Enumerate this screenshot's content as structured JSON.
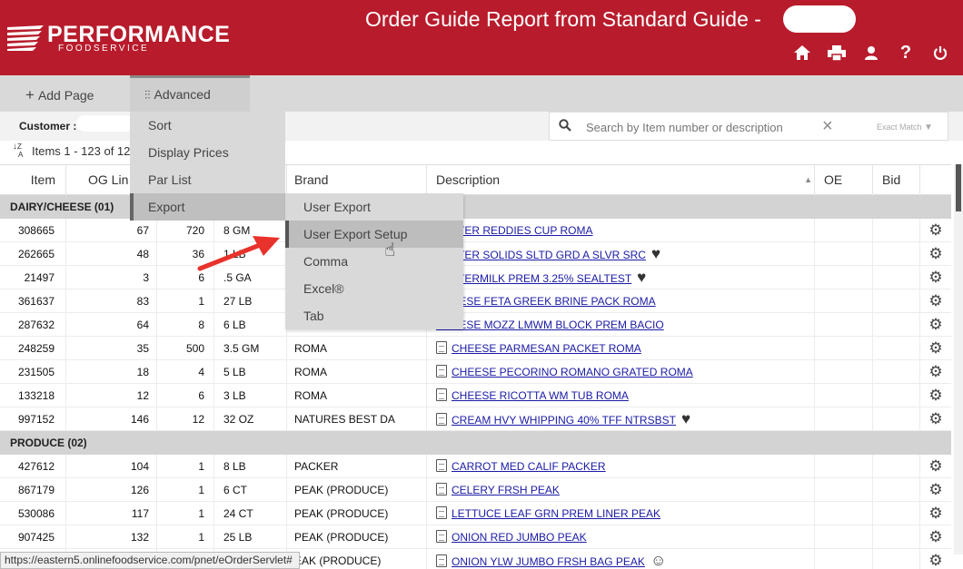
{
  "header": {
    "brand": "PERFORMANCE",
    "brand_sub": "FOODSERVICE",
    "title": "Order Guide Report from Standard Guide -",
    "icons": [
      "home-icon",
      "printer-icon",
      "user-icon",
      "help-icon",
      "power-icon"
    ]
  },
  "toolbar": {
    "add_page": "Add Page",
    "advanced": "Advanced"
  },
  "customer": {
    "label": "Customer :"
  },
  "search": {
    "placeholder": "Search by Item number or description",
    "exact_match": "Exact Match"
  },
  "items_count": "Items 1 - 123 of 12",
  "table": {
    "headers": {
      "item": "Item",
      "og_line": "OG Lin",
      "brand": "Brand",
      "description": "Description",
      "oe": "OE",
      "bid": "Bid"
    },
    "categories": [
      {
        "name": "DAIRY/CHEESE (01)",
        "rows": [
          {
            "item": "308665",
            "og": "67",
            "pack": "720",
            "size": "8 GM",
            "brand": "",
            "desc": "BUTTER REDDIES CUP ROMA",
            "heart": false,
            "pdf": false
          },
          {
            "item": "262665",
            "og": "48",
            "pack": "36",
            "size": "1 LB",
            "brand": "",
            "desc": "BUTTER SOLIDS SLTD GRD A SLVR SRC",
            "heart": true,
            "pdf": false
          },
          {
            "item": "21497",
            "og": "3",
            "pack": "6",
            "size": ".5 GA",
            "brand": "",
            "desc": "BUTTERMILK PREM 3.25% SEALTEST",
            "heart": true,
            "pdf": false
          },
          {
            "item": "361637",
            "og": "83",
            "pack": "1",
            "size": "27 LB",
            "brand": "",
            "desc": "CHEESE FETA GREEK BRINE PACK ROMA",
            "heart": false,
            "pdf": false
          },
          {
            "item": "287632",
            "og": "64",
            "pack": "8",
            "size": "6 LB",
            "brand": "",
            "desc": "CHEESE MOZZ LMWM BLOCK PREM BACIO",
            "heart": false,
            "pdf": false
          },
          {
            "item": "248259",
            "og": "35",
            "pack": "500",
            "size": "3.5 GM",
            "brand": "ROMA",
            "desc": "CHEESE PARMESAN PACKET ROMA",
            "heart": false,
            "pdf": true
          },
          {
            "item": "231505",
            "og": "18",
            "pack": "4",
            "size": "5 LB",
            "brand": "ROMA",
            "desc": "CHEESE PECORINO ROMANO GRATED ROMA",
            "heart": false,
            "pdf": true
          },
          {
            "item": "133218",
            "og": "12",
            "pack": "6",
            "size": "3 LB",
            "brand": "ROMA",
            "desc": "CHEESE RICOTTA WM TUB ROMA",
            "heart": false,
            "pdf": true
          },
          {
            "item": "997152",
            "og": "146",
            "pack": "12",
            "size": "32 OZ",
            "brand": "NATURES BEST DA",
            "desc": "CREAM HVY WHIPPING 40% TFF NTRSBST",
            "heart": true,
            "pdf": true
          }
        ]
      },
      {
        "name": "PRODUCE (02)",
        "rows": [
          {
            "item": "427612",
            "og": "104",
            "pack": "1",
            "size": "8 LB",
            "brand": "PACKER",
            "desc": "CARROT MED CALIF PACKER",
            "heart": false,
            "pdf": true
          },
          {
            "item": "867179",
            "og": "126",
            "pack": "1",
            "size": "6 CT",
            "brand": "PEAK (PRODUCE)",
            "desc": "CELERY FRSH PEAK",
            "heart": false,
            "pdf": true
          },
          {
            "item": "530086",
            "og": "117",
            "pack": "1",
            "size": "24 CT",
            "brand": "PEAK (PRODUCE)",
            "desc": "LETTUCE LEAF GRN PREM LINER PEAK",
            "heart": false,
            "pdf": true
          },
          {
            "item": "907425",
            "og": "132",
            "pack": "1",
            "size": "25 LB",
            "brand": "PEAK (PRODUCE)",
            "desc": "ONION RED JUMBO PEAK",
            "heart": false,
            "pdf": true
          },
          {
            "item": "",
            "og": "",
            "pack": "",
            "size": "",
            "brand": "EAK (PRODUCE)",
            "desc": "ONION YLW JUMBO FRSH BAG PEAK",
            "heart": false,
            "pdf": true,
            "smile": true
          }
        ]
      }
    ]
  },
  "advanced_menu": [
    "Sort",
    "Display Prices",
    "Par List",
    "Export"
  ],
  "export_menu": [
    "User Export",
    "User Export Setup",
    "Comma",
    "Excel®",
    "Tab"
  ],
  "status_bar": "https://eastern5.onlinefoodservice.com/pnet/eOrderServlet#"
}
